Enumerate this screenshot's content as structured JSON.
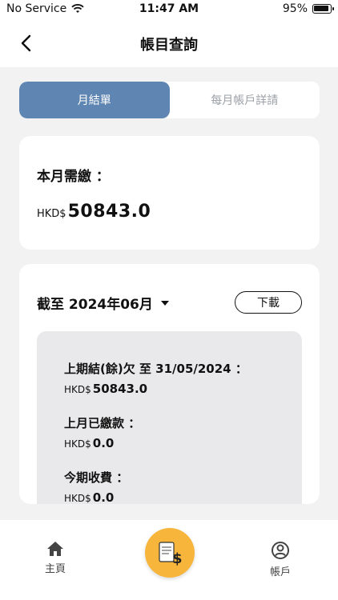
{
  "status_bar": {
    "carrier": "No Service",
    "time": "11:47 AM",
    "battery": "95%"
  },
  "header": {
    "title": "帳目查詢"
  },
  "tabs": [
    {
      "label": "月結單",
      "active": true
    },
    {
      "label": "每月帳戶詳請",
      "active": false
    }
  ],
  "due": {
    "title": "本月需繳 ：",
    "currency": "HKD$",
    "amount": "50843.0"
  },
  "statement": {
    "month_label": "截至 2024年06月",
    "download_label": "下載",
    "items": [
      {
        "label": "上期結(餘)欠 至 31/05/2024 ：",
        "currency": "HKD$",
        "value": "50843.0"
      },
      {
        "label": "上月已繳款 ：",
        "currency": "HKD$",
        "value": "0.0"
      },
      {
        "label": "今期收費 ：",
        "currency": "HKD$",
        "value": "0.0"
      }
    ]
  },
  "bottom_nav": {
    "home_label": "主頁",
    "account_label": "帳戶"
  },
  "colors": {
    "accent_blue": "#5f86b2",
    "center_button": "#f7b53b"
  }
}
